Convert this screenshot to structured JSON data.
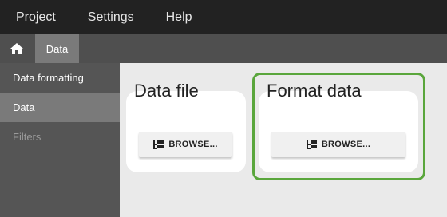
{
  "menubar": {
    "items": [
      "Project",
      "Settings",
      "Help"
    ]
  },
  "tabbar": {
    "home_icon": "home-icon",
    "active_tab": "Data"
  },
  "sidebar": {
    "items": [
      {
        "label": "Data formatting",
        "state": "normal"
      },
      {
        "label": "Data",
        "state": "active"
      },
      {
        "label": "Filters",
        "state": "disabled"
      }
    ]
  },
  "main": {
    "data_file": {
      "title": "Data file",
      "button_label": "BROWSE...",
      "button_icon": "folder-tree-icon"
    },
    "format_data": {
      "title": "Format data",
      "button_label": "BROWSE...",
      "button_icon": "folder-tree-icon",
      "highlight_color": "#5aa63c"
    }
  },
  "colors": {
    "menubar_bg": "#222222",
    "tabbar_bg": "#4f4f4f",
    "sidebar_bg": "#555555",
    "active_bg": "#7a7a7a",
    "content_bg": "#eaeaea"
  }
}
